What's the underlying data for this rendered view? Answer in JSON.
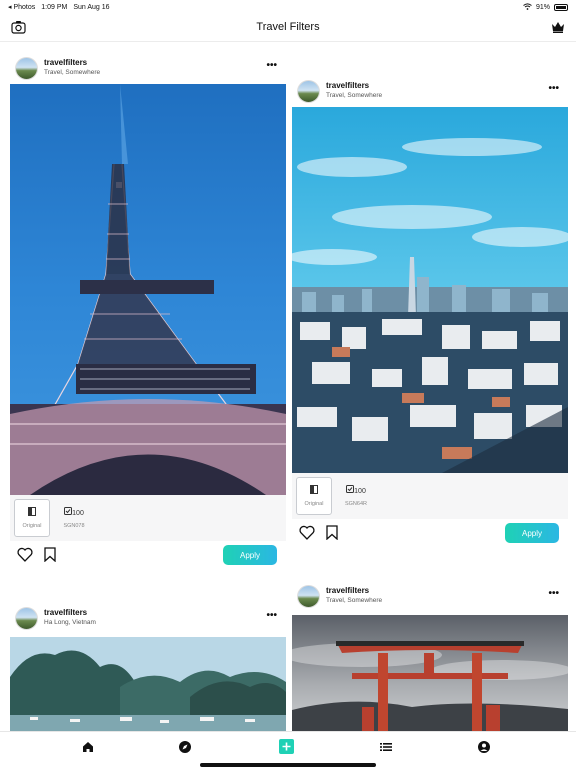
{
  "status_bar": {
    "back_app": "◂ Photos",
    "time": "1:09 PM",
    "date": "Sun Aug 16",
    "battery": "91%"
  },
  "header": {
    "title": "Travel Filters",
    "left_icon": "camera-icon",
    "right_icon": "crown-icon"
  },
  "posts": [
    {
      "username": "travelfilters",
      "location": "Travel, Somewhere",
      "photo": "eiffel-tower",
      "filters": [
        {
          "label": "Original",
          "icon": "original-icon",
          "value": ""
        },
        {
          "label": "SGN078",
          "icon": "filter-icon",
          "value": "100"
        }
      ],
      "apply_label": "Apply"
    },
    {
      "username": "travelfilters",
      "location": "Travel, Somewhere",
      "photo": "city-skyline",
      "filters": [
        {
          "label": "Original",
          "icon": "original-icon",
          "value": ""
        },
        {
          "label": "SGN64R",
          "icon": "filter-icon",
          "value": "100"
        }
      ],
      "apply_label": "Apply"
    },
    {
      "username": "travelfilters",
      "location": "Ha Long, Vietnam",
      "photo": "ha-long-bay"
    },
    {
      "username": "travelfilters",
      "location": "Travel, Somewhere",
      "photo": "torii-gate"
    }
  ],
  "tab_bar": {
    "tabs": [
      "home-icon",
      "compass-icon",
      "add-icon",
      "list-icon",
      "profile-icon"
    ],
    "accent": "#1fd1b5"
  }
}
